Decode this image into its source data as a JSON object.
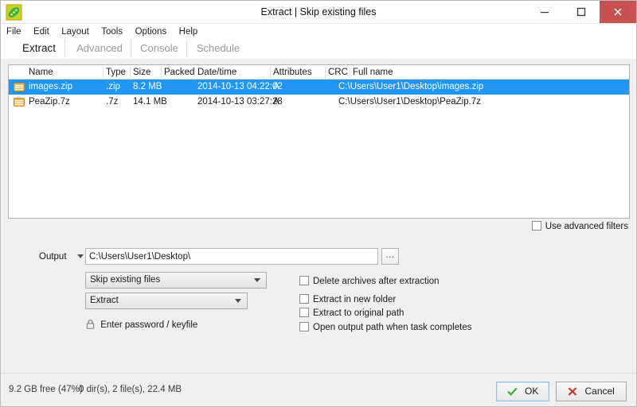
{
  "window": {
    "title": "Extract | Skip existing files",
    "icon": "peazip-logo-icon",
    "minimize_label": "minimize-icon",
    "maximize_label": "maximize-icon",
    "close_label": "close-icon"
  },
  "menubar": {
    "items": [
      {
        "label": "File"
      },
      {
        "label": "Edit"
      },
      {
        "label": "Layout"
      },
      {
        "label": "Tools"
      },
      {
        "label": "Options"
      },
      {
        "label": "Help"
      }
    ]
  },
  "tabs": [
    {
      "label": "Extract",
      "active": true
    },
    {
      "label": "Advanced",
      "active": false
    },
    {
      "label": "Console",
      "active": false
    },
    {
      "label": "Schedule",
      "active": false
    }
  ],
  "filelist": {
    "columns": [
      {
        "label": "Name"
      },
      {
        "label": "Type"
      },
      {
        "label": "Size"
      },
      {
        "label": "Packed"
      },
      {
        "label": "Date/time"
      },
      {
        "label": "Attributes"
      },
      {
        "label": "CRC"
      },
      {
        "label": "Full name"
      }
    ],
    "rows": [
      {
        "icon": "archive-icon",
        "name": "images.zip",
        "type": ".zip",
        "size": "8.2 MB",
        "packed": "",
        "datetime": "2014-10-13 04:22:02",
        "attributes": "A",
        "crc": "",
        "fullname": "C:\\Users\\User1\\Desktop\\images.zip",
        "selected": true
      },
      {
        "icon": "archive-icon",
        "name": "PeaZip.7z",
        "type": ".7z",
        "size": "14.1 MB",
        "packed": "",
        "datetime": "2014-10-13 03:27:28",
        "attributes": "A",
        "crc": "",
        "fullname": "C:\\Users\\User1\\Desktop\\PeaZip.7z",
        "selected": false
      }
    ]
  },
  "advanced_filters": {
    "label": "Use advanced filters",
    "checked": false
  },
  "output": {
    "label": "Output",
    "dropdown_icon": "chevron-down-icon",
    "path_value": "C:\\Users\\User1\\Desktop\\",
    "path_placeholder": "C:\\Users\\User1\\Desktop\\",
    "browse_label": "...",
    "overwrite_mode": "Skip existing files",
    "action_mode": "Extract",
    "password_label": "Enter password / keyfile",
    "password_icon": "lock-icon"
  },
  "options": [
    {
      "label": "Delete archives after extraction",
      "checked": false
    },
    {
      "label": "Extract in new folder",
      "checked": false
    },
    {
      "label": "Extract to original path",
      "checked": false
    },
    {
      "label": "Open output path when task completes",
      "checked": false
    }
  ],
  "statusbar": {
    "free_space": "9.2 GB free (47%)",
    "selection_info": "0 dir(s), 2 file(s), 22.4 MB",
    "ok_label": "OK",
    "cancel_label": "Cancel",
    "ok_icon": "checkmark-icon",
    "cancel_icon": "x-mark-icon"
  },
  "colors": {
    "selection": "#2196f3",
    "close_button": "#c75050",
    "ok_check": "#3faa3f",
    "cancel_x": "#c0392b",
    "window_bg": "#f0f0f0"
  }
}
